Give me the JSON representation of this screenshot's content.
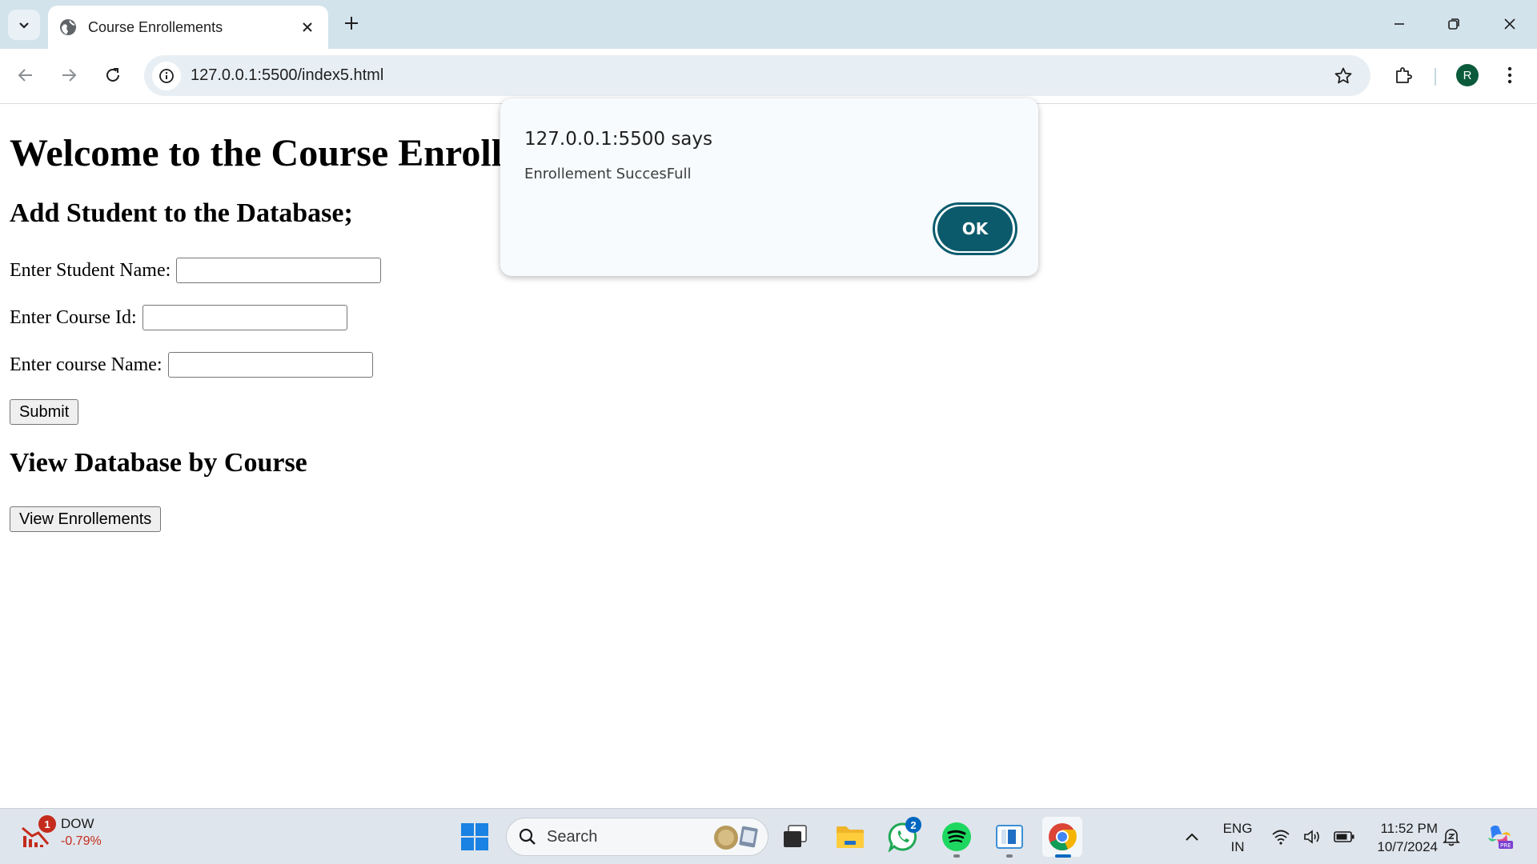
{
  "browser": {
    "tab_title": "Course Enrollements",
    "url": "127.0.0.1:5500/index5.html",
    "profile_initial": "R"
  },
  "page": {
    "heading": "Welcome to the Course Enroll",
    "add_heading": "Add Student to the Database;",
    "student_name_label": "Enter Student Name:",
    "course_id_label": "Enter Course Id:",
    "course_name_label": "Enter course Name:",
    "submit_label": "Submit",
    "view_heading": "View Database by Course",
    "view_button_label": "View Enrollements"
  },
  "dialog": {
    "title": "127.0.0.1:5500 says",
    "message": "Enrollement SuccesFull",
    "ok_label": "OK"
  },
  "taskbar": {
    "widget_name": "DOW",
    "widget_value": "-0.79%",
    "widget_badge": "1",
    "search_label": "Search",
    "whatsapp_badge": "2",
    "language_line1": "ENG",
    "language_line2": "IN",
    "time": "11:52 PM",
    "date": "10/7/2024"
  },
  "colors": {
    "accent": "#0b5a6b",
    "tabstrip": "#d3e3ec",
    "taskbar": "#dfe5ec"
  }
}
